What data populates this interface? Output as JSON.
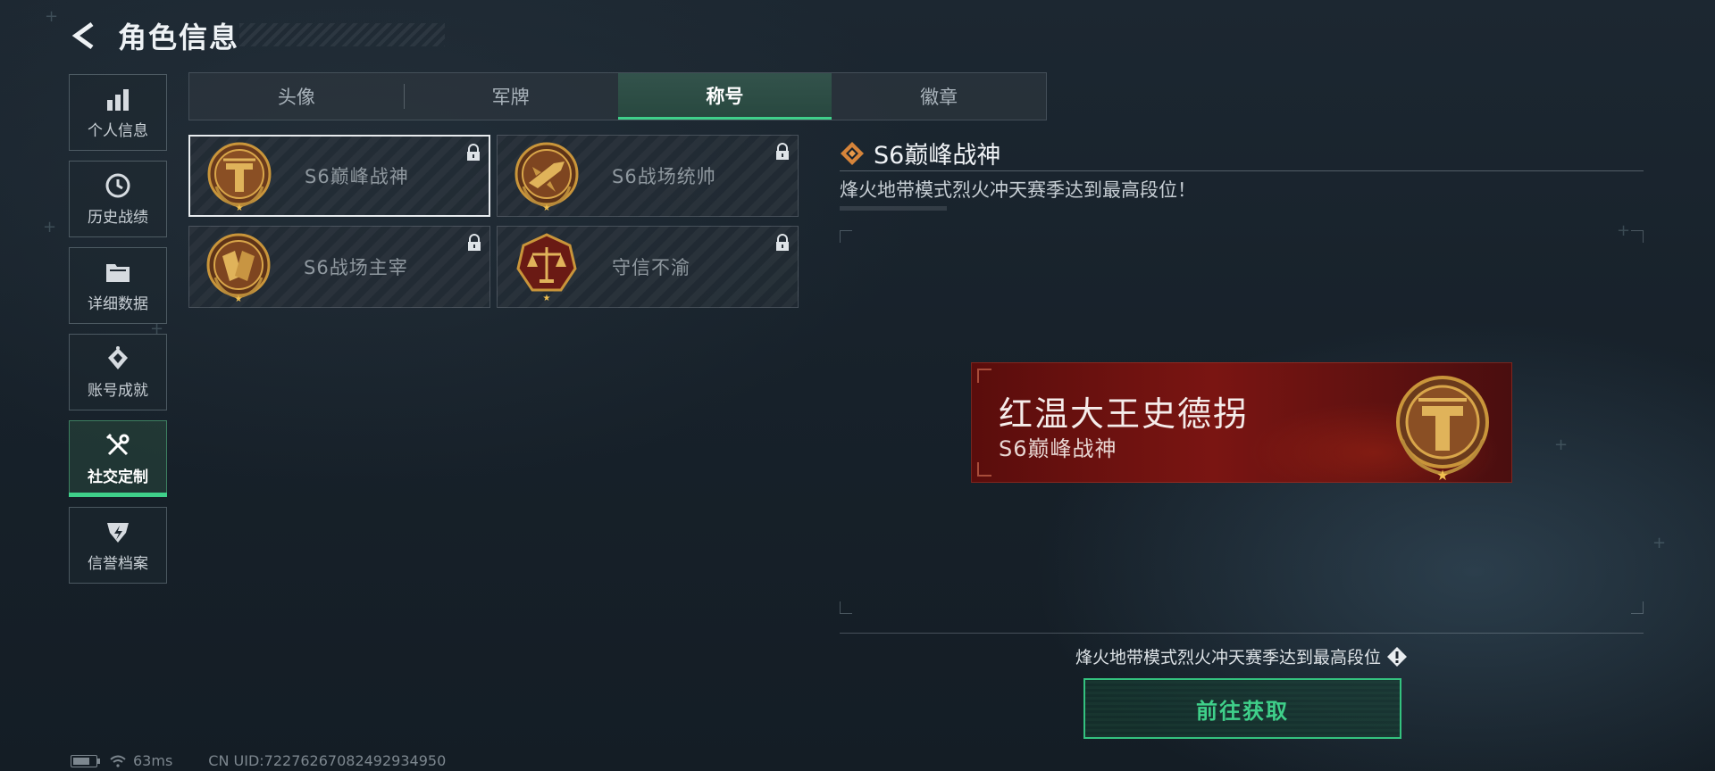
{
  "header": {
    "title": "角色信息",
    "back_icon": "back-arrow-icon"
  },
  "sidebar": {
    "items": [
      {
        "label": "个人信息",
        "icon": "bar-chart-icon",
        "active": false
      },
      {
        "label": "历史战绩",
        "icon": "clock-icon",
        "active": false
      },
      {
        "label": "详细数据",
        "icon": "folder-icon",
        "active": false
      },
      {
        "label": "账号成就",
        "icon": "achievement-icon",
        "active": false
      },
      {
        "label": "社交定制",
        "icon": "tools-icon",
        "active": true
      },
      {
        "label": "信誉档案",
        "icon": "shield-icon",
        "active": false
      }
    ]
  },
  "tabs": [
    {
      "label": "头像",
      "active": false
    },
    {
      "label": "军牌",
      "active": false
    },
    {
      "label": "称号",
      "active": true
    },
    {
      "label": "徽章",
      "active": false
    }
  ],
  "cards": [
    {
      "name": "S6巅峰战神",
      "emblem": "titan-emblem",
      "locked": true,
      "selected": true
    },
    {
      "name": "S6战场统帅",
      "emblem": "jet-emblem",
      "locked": true,
      "selected": false
    },
    {
      "name": "S6战场主宰",
      "emblem": "gauntlet-emblem",
      "locked": true,
      "selected": false
    },
    {
      "name": "守信不渝",
      "emblem": "scales-emblem",
      "locked": true,
      "selected": false
    }
  ],
  "detail": {
    "title": "S6巅峰战神",
    "description": "烽火地带模式烈火冲天赛季达到最高段位！"
  },
  "nameplate": {
    "player_name": "红温大王史德拐",
    "title": "S6巅峰战神"
  },
  "requirement": {
    "text": "烽火地带模式烈火冲天赛季达到最高段位",
    "icon": "info-icon"
  },
  "action_button": {
    "label": "前往获取"
  },
  "status_bar": {
    "ping": "63ms",
    "uid": "CN UID:72276267082492934950"
  },
  "colors": {
    "accent_green": "#3fd08a",
    "nameplate_red": "#7a1512",
    "emblem_gold": "#c9953a"
  }
}
